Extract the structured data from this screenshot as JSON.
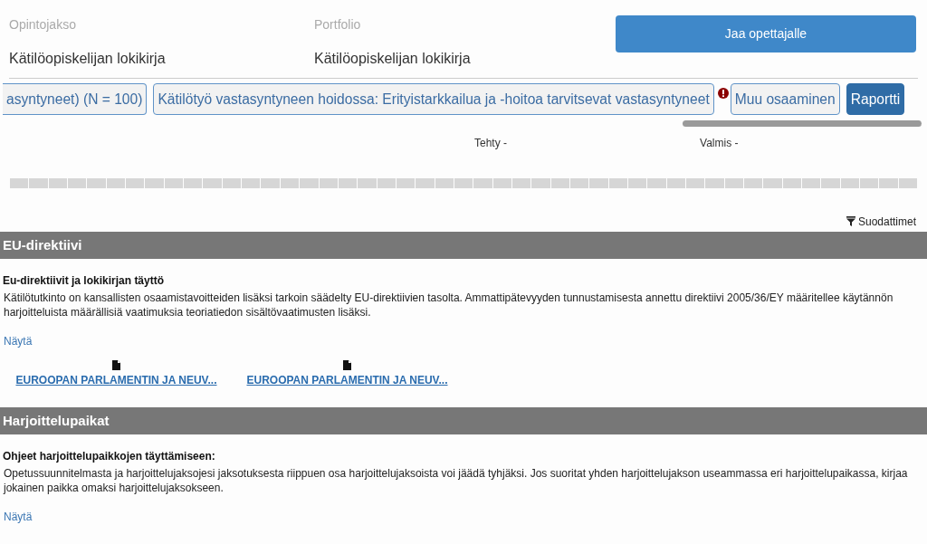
{
  "header": {
    "fields": [
      {
        "label": "Opintojakso",
        "value": "Kätilöopiskelijan lokikirja"
      },
      {
        "label": "Portfolio",
        "value": "Kätilöopiskelijan lokikirja"
      }
    ],
    "share_button": "Jaa opettajalle"
  },
  "tabs": [
    {
      "label": "asyntyneet) (N = 100)",
      "selected": false,
      "warning": false
    },
    {
      "label": "Kätilötyö vastasyntyneen hoidossa: Erityistarkkailua ja -hoitoa tarvitsevat vastasyntyneet",
      "selected": false,
      "warning": false
    },
    {
      "label": "Muu osaaminen",
      "selected": false,
      "warning": true
    },
    {
      "label": "Raportti",
      "selected": true,
      "warning": false
    }
  ],
  "progress": {
    "done_label": "Tehty -",
    "ready_label": "Valmis -"
  },
  "filters_button": "Suodattimet",
  "sections": [
    {
      "title": "EU-direktiivi",
      "subtitle": "Eu-direktiivit ja lokikirjan täyttö",
      "text": "Kätilötutkinto on kansallisten osaamistavoitteiden lisäksi tarkoin säädelty EU-direktiivien tasolta. Ammattipätevyyden tunnustamisesta annettu direktiivi 2005/36/EY määritellee käytännön harjoitteluista määrällisiä vaatimuksia teoriatiedon sisältövaatimusten lisäksi.",
      "show_link": "Näytä",
      "files": [
        {
          "name": "EUROOPAN PARLAMENTIN JA NEUV..."
        },
        {
          "name": "EUROOPAN PARLAMENTIN JA NEUV..."
        }
      ]
    },
    {
      "title": "Harjoittelupaikat",
      "subtitle": "Ohjeet harjoittelupaikkojen täyttämiseen:",
      "text": "Opetussuunnitelmasta ja harjoittelujaksojesi jaksotuksesta riippuen osa harjoittelujaksoista voi jäädä tyhjäksi. Jos suoritat yhden harjoittelujakson useammassa eri harjoittelupaikassa, kirjaa jokainen paikka omaksi harjoittelujaksokseen.",
      "show_link": "Näytä"
    }
  ]
}
